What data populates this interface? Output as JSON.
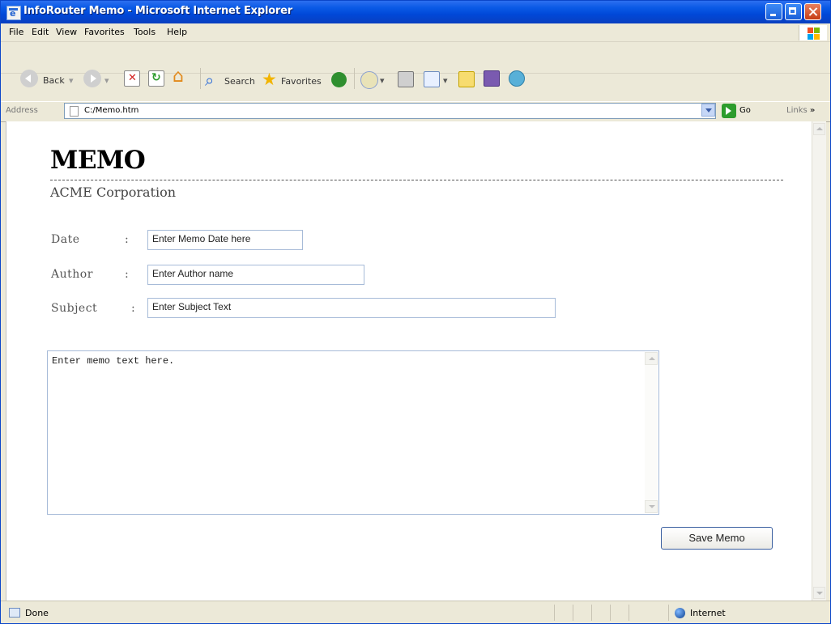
{
  "window": {
    "title": "InfoRouter Memo - Microsoft Internet Explorer"
  },
  "menu": [
    "File",
    "Edit",
    "View",
    "Favorites",
    "Tools",
    "Help"
  ],
  "toolbar": {
    "back_label": "Back",
    "search_label": "Search",
    "favorites_label": "Favorites"
  },
  "address": {
    "label": "Address",
    "value": "C:/Memo.htm",
    "go_label": "Go",
    "links_label": "Links"
  },
  "memo": {
    "title": "MEMO",
    "company": "ACME Corporation",
    "fields": [
      {
        "label": "Date",
        "value": "Enter Memo Date here"
      },
      {
        "label": "Author",
        "value": "Enter Author name"
      },
      {
        "label": "Subject",
        "value": "Enter Subject Text"
      }
    ],
    "colon": ":",
    "body_text": "Enter memo text here.",
    "save_label": "Save Memo"
  },
  "status": {
    "text": "Done",
    "zone": "Internet"
  },
  "colors": {
    "titlebar": "#0a5ae6",
    "chrome": "#ece9d8",
    "input_border": "#a7bbd8"
  }
}
